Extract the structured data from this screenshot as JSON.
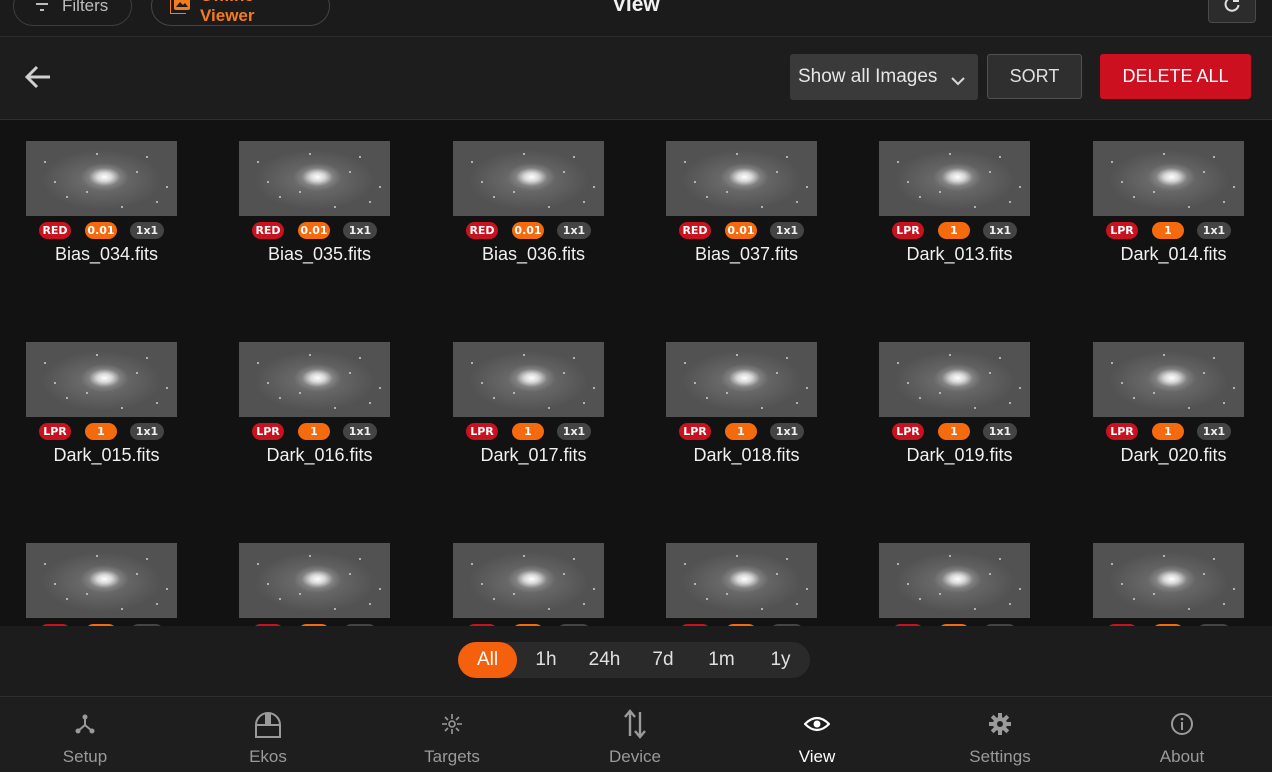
{
  "topbar": {
    "filters_label": "Filters",
    "offline_label": "Offline Viewer",
    "title": "View",
    "accent_color": "#f47b20"
  },
  "toolbar": {
    "select_value": "Show all Images",
    "sort_label": "SORT",
    "delete_label": "DELETE ALL",
    "delete_color": "#cc1020"
  },
  "images": [
    {
      "name": "Bias_034.fits",
      "filter": "RED",
      "exposure": "0.01",
      "binning": "1x1"
    },
    {
      "name": "Bias_035.fits",
      "filter": "RED",
      "exposure": "0.01",
      "binning": "1x1"
    },
    {
      "name": "Bias_036.fits",
      "filter": "RED",
      "exposure": "0.01",
      "binning": "1x1"
    },
    {
      "name": "Bias_037.fits",
      "filter": "RED",
      "exposure": "0.01",
      "binning": "1x1"
    },
    {
      "name": "Dark_013.fits",
      "filter": "LPR",
      "exposure": "1",
      "binning": "1x1"
    },
    {
      "name": "Dark_014.fits",
      "filter": "LPR",
      "exposure": "1",
      "binning": "1x1"
    },
    {
      "name": "Dark_015.fits",
      "filter": "LPR",
      "exposure": "1",
      "binning": "1x1"
    },
    {
      "name": "Dark_016.fits",
      "filter": "LPR",
      "exposure": "1",
      "binning": "1x1"
    },
    {
      "name": "Dark_017.fits",
      "filter": "LPR",
      "exposure": "1",
      "binning": "1x1"
    },
    {
      "name": "Dark_018.fits",
      "filter": "LPR",
      "exposure": "1",
      "binning": "1x1"
    },
    {
      "name": "Dark_019.fits",
      "filter": "LPR",
      "exposure": "1",
      "binning": "1x1"
    },
    {
      "name": "Dark_020.fits",
      "filter": "LPR",
      "exposure": "1",
      "binning": "1x1"
    },
    {
      "name": "",
      "filter": "",
      "exposure": "",
      "binning": ""
    },
    {
      "name": "",
      "filter": "",
      "exposure": "",
      "binning": ""
    },
    {
      "name": "",
      "filter": "",
      "exposure": "",
      "binning": ""
    },
    {
      "name": "",
      "filter": "",
      "exposure": "",
      "binning": ""
    },
    {
      "name": "",
      "filter": "",
      "exposure": "",
      "binning": ""
    },
    {
      "name": "",
      "filter": "",
      "exposure": "",
      "binning": ""
    }
  ],
  "time_filters": [
    {
      "label": "All",
      "active": true
    },
    {
      "label": "1h",
      "active": false
    },
    {
      "label": "24h",
      "active": false
    },
    {
      "label": "7d",
      "active": false
    },
    {
      "label": "1m",
      "active": false
    },
    {
      "label": "1y",
      "active": false
    }
  ],
  "nav": [
    {
      "label": "Setup",
      "icon": "setup-icon",
      "active": false
    },
    {
      "label": "Ekos",
      "icon": "ekos-icon",
      "active": false
    },
    {
      "label": "Targets",
      "icon": "targets-icon",
      "active": false
    },
    {
      "label": "Device",
      "icon": "device-icon",
      "active": false
    },
    {
      "label": "View",
      "icon": "eye-icon",
      "active": true
    },
    {
      "label": "Settings",
      "icon": "gear-icon",
      "active": false
    },
    {
      "label": "About",
      "icon": "info-icon",
      "active": false
    }
  ]
}
